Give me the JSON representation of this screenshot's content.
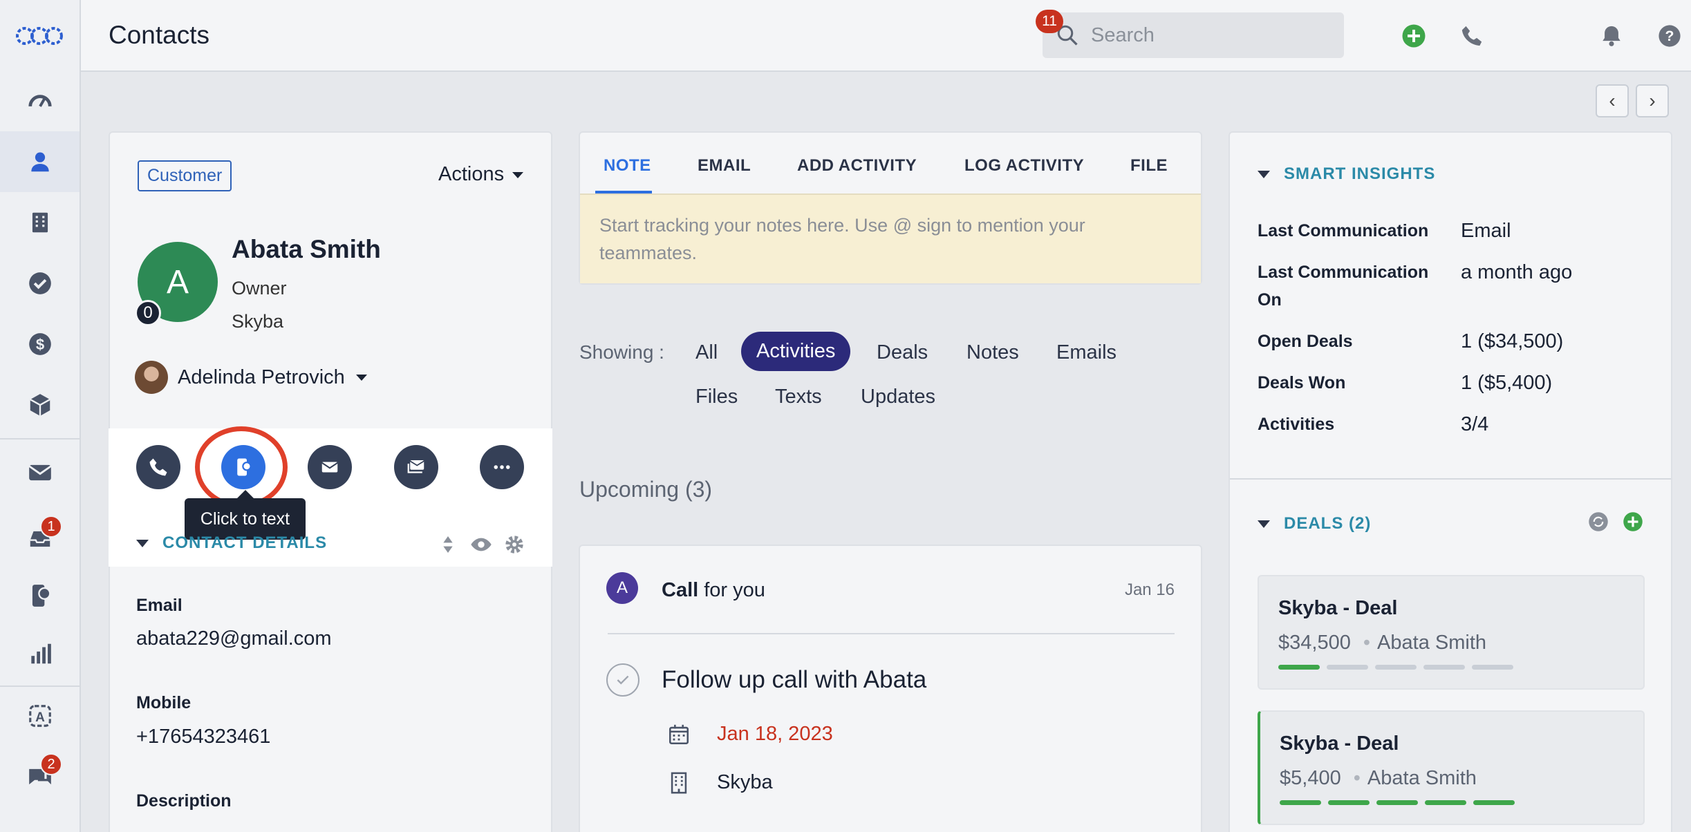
{
  "header": {
    "title": "Contacts",
    "search_placeholder": "Search",
    "notification_count": "11"
  },
  "sidebar": {
    "inbox_badge": "1",
    "chat_badge": "2"
  },
  "contact": {
    "tag": "Customer",
    "actions_label": "Actions",
    "avatar_letter": "A",
    "avatar_count": "0",
    "name": "Abata Smith",
    "title": "Owner",
    "company": "Skyba",
    "owner": "Adelinda Petrovich",
    "tooltip": "Click to text",
    "section_title": "CONTACT DETAILS",
    "fields": [
      {
        "label": "Email",
        "value": "abata229@gmail.com"
      },
      {
        "label": "Mobile",
        "value": "+17654323461"
      },
      {
        "label": "Description",
        "value": ""
      }
    ]
  },
  "composer": {
    "tabs": [
      "NOTE",
      "EMAIL",
      "ADD ACTIVITY",
      "LOG ACTIVITY",
      "FILE"
    ],
    "placeholder": "Start tracking your notes here. Use @ sign to mention your teammates."
  },
  "timeline": {
    "showing_label": "Showing :",
    "filters": [
      "All",
      "Activities",
      "Deals",
      "Notes",
      "Emails",
      "Files",
      "Texts",
      "Updates"
    ],
    "active_filter": "Activities",
    "upcoming_label": "Upcoming (3)",
    "item": {
      "avatar_letter": "A",
      "type": "Call",
      "suffix": "for you",
      "date": "Jan 16",
      "title": "Follow up call with Abata",
      "due_date": "Jan 18, 2023",
      "company": "Skyba"
    }
  },
  "insights": {
    "title": "SMART INSIGHTS",
    "rows": [
      {
        "label": "Last Communication",
        "value": "Email"
      },
      {
        "label": "Last Communication On",
        "value": "a month ago"
      },
      {
        "label": "Open Deals",
        "value": "1 ($34,500)"
      },
      {
        "label": "Deals Won",
        "value": "1 ($5,400)"
      },
      {
        "label": "Activities",
        "value": "3/4"
      }
    ]
  },
  "deals": {
    "title": "DEALS (2)",
    "items": [
      {
        "name": "Skyba - Deal",
        "amount": "$34,500",
        "contact": "Abata Smith",
        "stages_done": 1,
        "stages_total": 5
      },
      {
        "name": "Skyba - Deal",
        "amount": "$5,400",
        "contact": "Abata Smith",
        "stages_done": 5,
        "stages_total": 5
      }
    ]
  },
  "colors": {
    "accent": "#2d6fe0",
    "teal_heading": "#2b8aa8",
    "avatar_green": "#2d8a55",
    "badge_red": "#c8321e",
    "active_filter": "#2c2a7a",
    "stage_green": "#3ea64a"
  }
}
